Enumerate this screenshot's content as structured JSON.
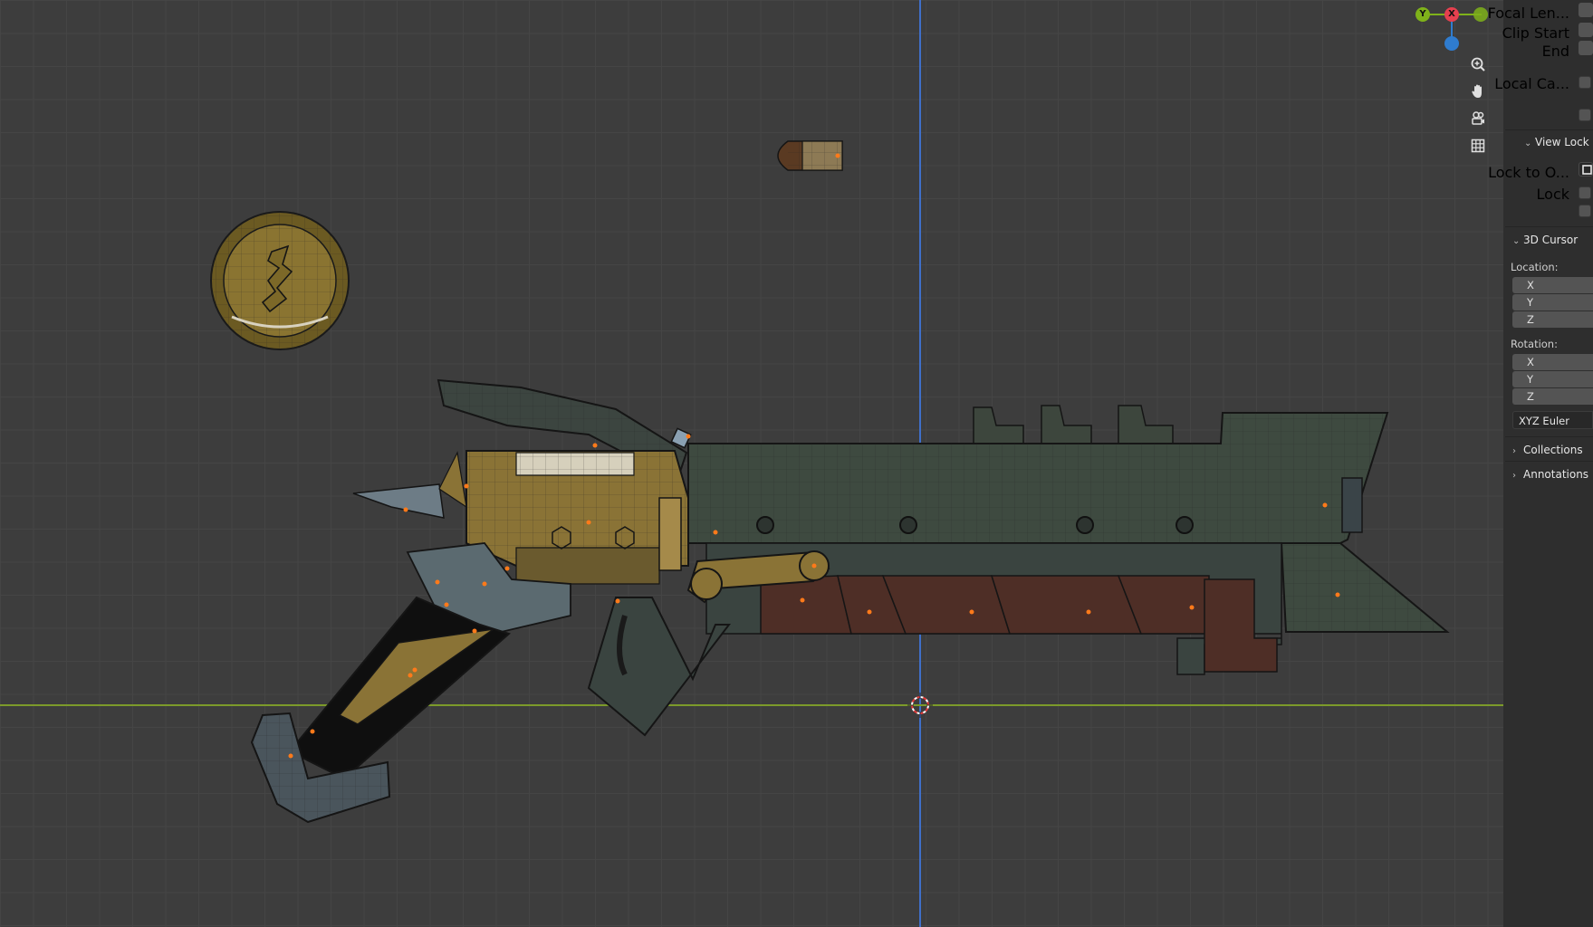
{
  "gizmo": {
    "y_axis": "Y",
    "x_axis": "X",
    "x_color": "#e5404f",
    "y_color": "#7fb21a",
    "z_color": "#2f7ccf"
  },
  "nav_icons": [
    "zoom-icon",
    "hand-pan-icon",
    "camera-icon",
    "grid-icon"
  ],
  "panel": {
    "view": {
      "focal_length_label": "Focal Len...",
      "clip_start_label": "Clip Start",
      "clip_end_label": "End",
      "local_camera_label": "Local Ca..."
    },
    "view_lock": {
      "header": "View Lock",
      "lock_to_object_label": "Lock to O...",
      "lock_label": "Lock"
    },
    "cursor": {
      "header": "3D Cursor",
      "location_label": "Location:",
      "location_axes": [
        "X",
        "Y",
        "Z"
      ],
      "rotation_label": "Rotation:",
      "rotation_axes": [
        "X",
        "Y",
        "Z"
      ],
      "rotation_mode": "XYZ Euler"
    },
    "collections_header": "Collections",
    "annotations_header": "Annotations"
  },
  "colors": {
    "viewport_bg": "#3d3d3d",
    "grid_line": "#454545",
    "x_axis_line": "#7c9a2a",
    "y_axis_line": "#3f6fc9",
    "panel_bg": "#2e2e2e",
    "origin_dot": "#ff7a1a"
  }
}
